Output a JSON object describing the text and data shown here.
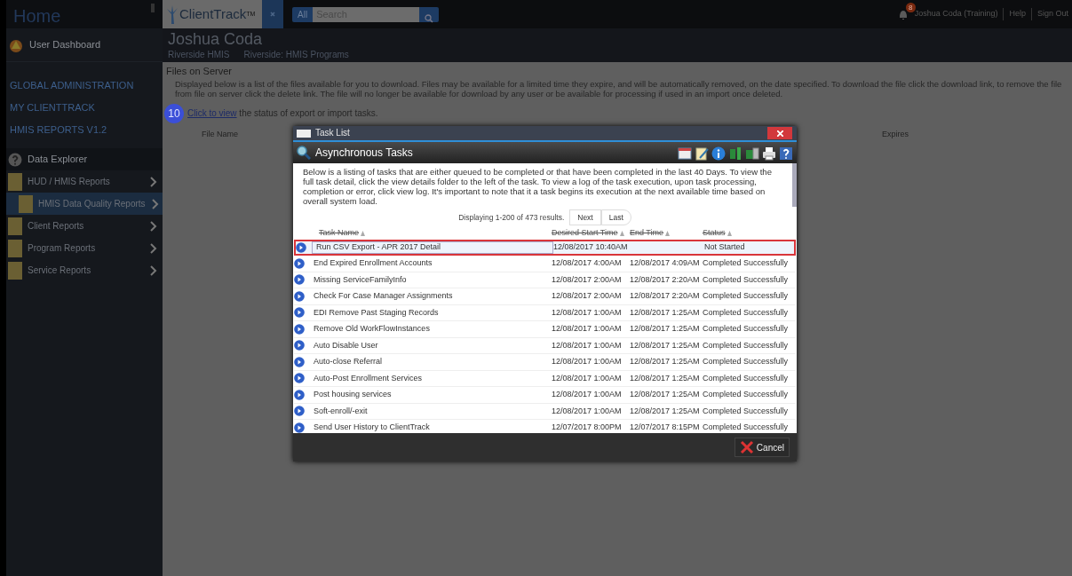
{
  "topbar": {
    "logo": "ClientTrack$^{TM}$",
    "search": {
      "scope": "All",
      "placeholder": "Search"
    },
    "notification_count": "8",
    "user": "Joshua Coda (Training)",
    "links": [
      "Help",
      "Sign Out"
    ]
  },
  "sidebar": {
    "title": "Home",
    "dashboard": "User Dashboard",
    "sections": [
      "GLOBAL ADMINISTRATION",
      "MY CLIENTTRACK",
      "HMIS REPORTS V1.2"
    ],
    "explorer": "Data Explorer",
    "items": [
      {
        "label": "HUD / HMIS Reports",
        "selected": false,
        "children": [
          {
            "label": "HMIS Data Quality Reports",
            "selected": true
          }
        ]
      },
      {
        "label": "Client Reports",
        "selected": false
      },
      {
        "label": "Program Reports",
        "selected": false
      },
      {
        "label": "Service Reports",
        "selected": false
      }
    ]
  },
  "page": {
    "title": "Joshua Coda",
    "breadcrumbs": [
      "Riverside HMIS",
      "Riverside: HMIS Programs"
    ],
    "section": "Files on Server",
    "description": "Displayed below is a list of the files available for you to download. Files may be available for a limited time they expire, and will be automatically removed, on the date specified. To download the file click the download link, to remove the file from file on server click the delete link. The file will no longer be available for download by any user or be available for processing if used in an import once deleted.",
    "step_badge": "10",
    "link": "Click to view",
    "link_suffix": " the status of export or import tasks.",
    "columns": [
      "File Name",
      "Expires"
    ]
  },
  "dialog": {
    "title": "Task List",
    "header": "Asynchronous Tasks",
    "description": "Below is a listing of tasks that are either queued to be completed or that have been completed in the last 40 Days. To view the full task detail, click the view details folder to the left of the task. To view a log of the task execution, upon task processing, completion or error, click view log. It's important to note that it a task begins its execution at the next available time based on overall system load.",
    "pager": "Displaying 1-200 of 473 results.",
    "pager_buttons": [
      "Next",
      "Last"
    ],
    "columns": [
      "Task Name",
      "Desired Start Time",
      "End Time",
      "Status"
    ],
    "rows": [
      {
        "name": "Run CSV Export - APR 2017 Detail",
        "start": "12/08/2017 10:40AM",
        "end": "",
        "status": "Not Started",
        "selected": true
      },
      {
        "name": "End Expired Enrollment Accounts",
        "start": "12/08/2017 4:00AM",
        "end": "12/08/2017 4:09AM",
        "status": "Completed Successfully",
        "selected": false
      },
      {
        "name": "Missing ServiceFamilyInfo",
        "start": "12/08/2017 2:00AM",
        "end": "12/08/2017 2:20AM",
        "status": "Completed Successfully",
        "selected": false
      },
      {
        "name": "Check For Case Manager Assignments",
        "start": "12/08/2017 2:00AM",
        "end": "12/08/2017 2:20AM",
        "status": "Completed Successfully",
        "selected": false
      },
      {
        "name": "EDI Remove Past Staging Records",
        "start": "12/08/2017 1:00AM",
        "end": "12/08/2017 1:25AM",
        "status": "Completed Successfully",
        "selected": false
      },
      {
        "name": "Remove Old WorkFlowInstances",
        "start": "12/08/2017 1:00AM",
        "end": "12/08/2017 1:25AM",
        "status": "Completed Successfully",
        "selected": false
      },
      {
        "name": "Auto Disable User",
        "start": "12/08/2017 1:00AM",
        "end": "12/08/2017 1:25AM",
        "status": "Completed Successfully",
        "selected": false
      },
      {
        "name": "Auto-close Referral",
        "start": "12/08/2017 1:00AM",
        "end": "12/08/2017 1:25AM",
        "status": "Completed Successfully",
        "selected": false
      },
      {
        "name": "Auto-Post Enrollment Services",
        "start": "12/08/2017 1:00AM",
        "end": "12/08/2017 1:25AM",
        "status": "Completed Successfully",
        "selected": false
      },
      {
        "name": "Post housing services",
        "start": "12/08/2017 1:00AM",
        "end": "12/08/2017 1:25AM",
        "status": "Completed Successfully",
        "selected": false
      },
      {
        "name": "Soft-enroll/-exit",
        "start": "12/08/2017 1:00AM",
        "end": "12/08/2017 1:25AM",
        "status": "Completed Successfully",
        "selected": false
      },
      {
        "name": "Send User History to ClientTrack",
        "start": "12/07/2017 8:00PM",
        "end": "12/07/2017 8:15PM",
        "status": "Completed Successfully",
        "selected": false
      }
    ],
    "cancel": "Cancel"
  }
}
